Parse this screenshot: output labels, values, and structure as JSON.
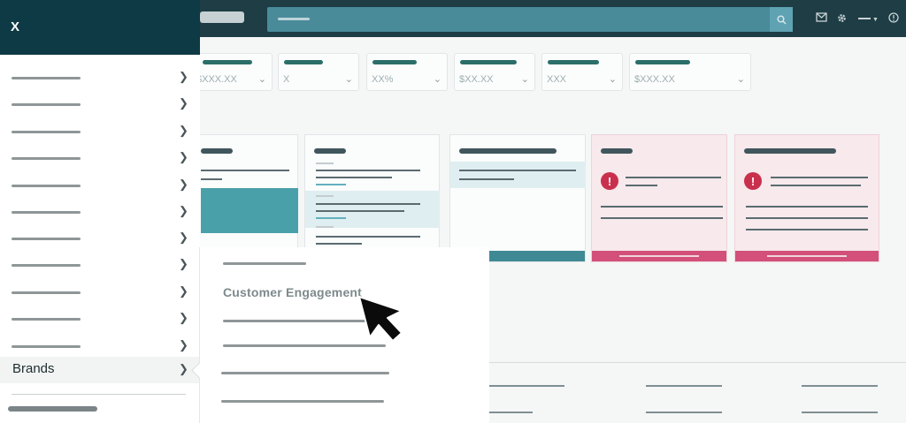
{
  "sidenav": {
    "close_label": "X",
    "active_item_label": "Brands",
    "icons": {
      "close": "close-x-icon",
      "chevron": "chevron-right-icon"
    }
  },
  "flyout": {
    "item_label": "Customer Engagement"
  },
  "filters": [
    {
      "value": "$XXX.XX"
    },
    {
      "value": "X"
    },
    {
      "value": "XX%"
    },
    {
      "value": "$XX.XX"
    },
    {
      "value": "XXX"
    },
    {
      "value": "$XXX.XX"
    }
  ],
  "alerts": {
    "icon_glyph": "!"
  },
  "colors": {
    "topbar": "#1e3d45",
    "nav_header": "#0e3a45",
    "search": "#4a8b9a",
    "teal_accent": "#3f8995",
    "alert_accent": "#d2507a",
    "alert_icon": "#c9304e"
  }
}
